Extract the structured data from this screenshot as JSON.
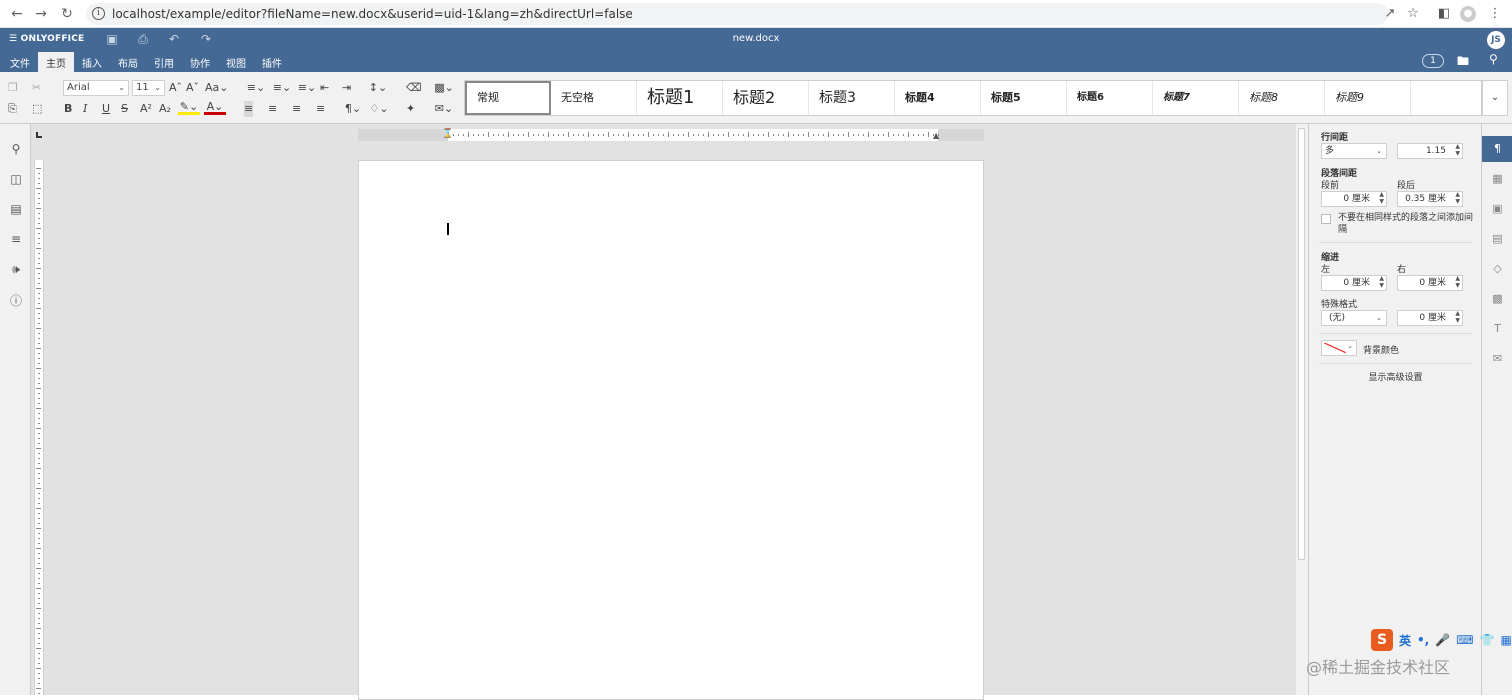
{
  "browser": {
    "url": "localhost/example/editor?fileName=new.docx&userid=uid-1&lang=zh&directUrl=false",
    "back_icon": "arrow-left-icon",
    "forward_icon": "arrow-right-icon",
    "reload_icon": "reload-icon"
  },
  "header": {
    "logo": "ONLYOFFICE",
    "doc_title": "new.docx",
    "user_initials": "JS",
    "users_count": "1",
    "tabs": [
      "文件",
      "主页",
      "插入",
      "布局",
      "引用",
      "协作",
      "视图",
      "插件"
    ],
    "active_tab": "主页"
  },
  "toolbar": {
    "font_name": "Arial",
    "font_size": "11",
    "styles": [
      "常规",
      "无空格",
      "标题1",
      "标题2",
      "标题3",
      "标题4",
      "标题5",
      "标题6",
      "标题7",
      "标题8",
      "标题9"
    ]
  },
  "right_panel": {
    "line_spacing_label": "行间距",
    "line_spacing_mode": "多",
    "line_spacing_value": "1.15",
    "para_spacing_label": "段落间距",
    "before_label": "段前",
    "before_value": "0 厘米",
    "after_label": "段后",
    "after_value": "0.35 厘米",
    "no_space_same_style": "不要在相同样式的段落之间添加间隔",
    "indent_label": "缩进",
    "left_label": "左",
    "left_value": "0 厘米",
    "right_label": "右",
    "right_value": "0 厘米",
    "special_label": "特殊格式",
    "special_mode": "(无)",
    "special_value": "0 厘米",
    "bg_color_label": "背景颜色",
    "advanced_label": "显示高级设置"
  },
  "ime": {
    "logo": "S",
    "lang": "英",
    "punct": "•,"
  },
  "watermark": "@稀土掘金技术社区",
  "colors": {
    "header_bg": "#446995",
    "toolbar_bg": "#f1f1f1",
    "canvas_bg": "#e2e2e2"
  }
}
